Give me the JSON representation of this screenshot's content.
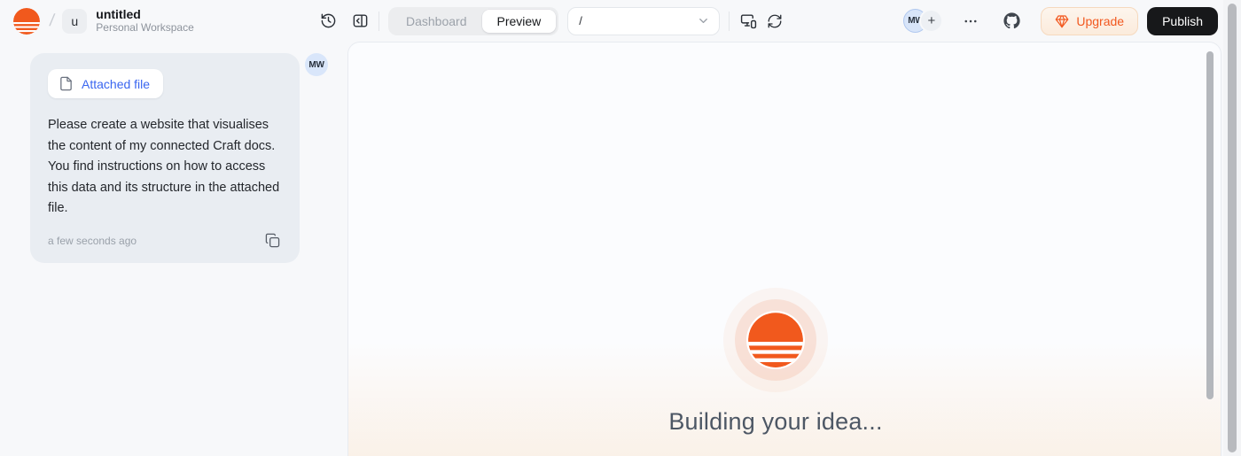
{
  "header": {
    "breadcrumb_separator": "/",
    "workspace_initial": "u",
    "project_title": "untitled",
    "workspace_name": "Personal Workspace",
    "tabs": {
      "dashboard": "Dashboard",
      "preview": "Preview"
    },
    "url_bar": {
      "path": "/"
    },
    "avatar_initials": "MW",
    "add_label": "+",
    "upgrade_label": "Upgrade",
    "publish_label": "Publish"
  },
  "chat": {
    "attachment_label": "Attached file",
    "message": "Please create a website that visualises the content of my connected Craft docs. You find instructions on how to access this data and its structure in the attached file.",
    "timestamp": "a few seconds ago",
    "avatar_initials": "MW"
  },
  "preview": {
    "status_text": "Building your idea..."
  },
  "icons": {
    "app-logo": "sunset-stripes-circle",
    "history-icon": "clock-rotate-ccw",
    "panel-toggle-icon": "panel-collapse-left",
    "chevron-down-icon": "chevron-down",
    "devices-icon": "monitor-smartphone",
    "refresh-icon": "rotate-cw",
    "more-icon": "ellipsis-dots",
    "github-icon": "github-mark",
    "gem-icon": "gem",
    "file-icon": "file-outline",
    "copy-icon": "copy-squares"
  },
  "colors": {
    "brand_orange": "#F1591D",
    "page_bg": "#F7F8FA",
    "bubble_bg": "#E9EDF2",
    "chip_link_blue": "#3A66F0",
    "avatar_blue": "#D8E5F9",
    "upgrade_text": "#F2581F",
    "upgrade_bg": "#FCF1E6",
    "publish_bg": "#17181A",
    "status_text": "#4D5765"
  }
}
